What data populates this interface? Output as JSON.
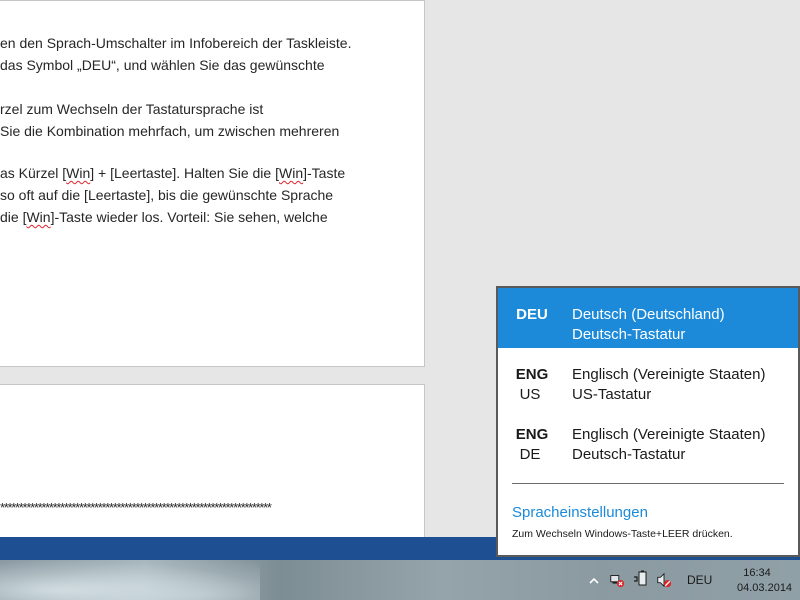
{
  "document": {
    "lines": [
      {
        "parts": [
          {
            "t": "en den Sprach-Umschalter im Infobereich der Taskleiste."
          }
        ]
      },
      {
        "parts": [
          {
            "t": "das Symbol „DEU“, und wählen Sie das gewünschte"
          }
        ]
      },
      {
        "parts": [
          {
            "t": ""
          }
        ]
      },
      {
        "parts": [
          {
            "t": "rzel zum Wechseln der Tastatursprache ist"
          }
        ]
      },
      {
        "parts": [
          {
            "t": " Sie die Kombination mehrfach, um zwischen mehreren"
          }
        ]
      },
      {
        "parts": [
          {
            "t": ""
          }
        ]
      },
      {
        "parts": [
          {
            "t": "as Kürzel ["
          },
          {
            "t": "Win",
            "spell": true
          },
          {
            "t": "] + [Leertaste]. Halten Sie die ["
          },
          {
            "t": "Win",
            "spell": true
          },
          {
            "t": "]-Taste"
          }
        ]
      },
      {
        "parts": [
          {
            "t": "so oft auf die [Leertaste], bis die gewünschte Sprache"
          }
        ]
      },
      {
        "parts": [
          {
            "t": " die ["
          },
          {
            "t": "Win",
            "spell": true
          },
          {
            "t": "]-Taste wieder los. Vorteil: Sie sehen, welche"
          }
        ]
      }
    ],
    "separator": "************************************************************************"
  },
  "language_flyout": {
    "items": [
      {
        "code": "DEU",
        "sub": "",
        "name": "Deutsch (Deutschland)",
        "keyboard": "Deutsch-Tastatur",
        "selected": true
      },
      {
        "code": "ENG",
        "sub": "US",
        "name": "Englisch (Vereinigte Staaten)",
        "keyboard": "US-Tastatur",
        "selected": false
      },
      {
        "code": "ENG",
        "sub": "DE",
        "name": "Englisch (Vereinigte Staaten)",
        "keyboard": "Deutsch-Tastatur",
        "selected": false
      }
    ],
    "settings_link": "Spracheinstellungen",
    "hint": "Zum Wechseln Windows-Taste+LEER drücken."
  },
  "taskbar": {
    "tray_icons": [
      "show-hidden-icons-chevron",
      "network-disconnected-icon",
      "power-icon",
      "volume-muted-icon"
    ],
    "language_indicator": "DEU",
    "clock": {
      "time": "16:34",
      "date": "04.03.2014"
    }
  },
  "colors": {
    "accent": "#1c8ad9",
    "ribbon": "#1f4f93",
    "spell_error": "#e0242c"
  }
}
